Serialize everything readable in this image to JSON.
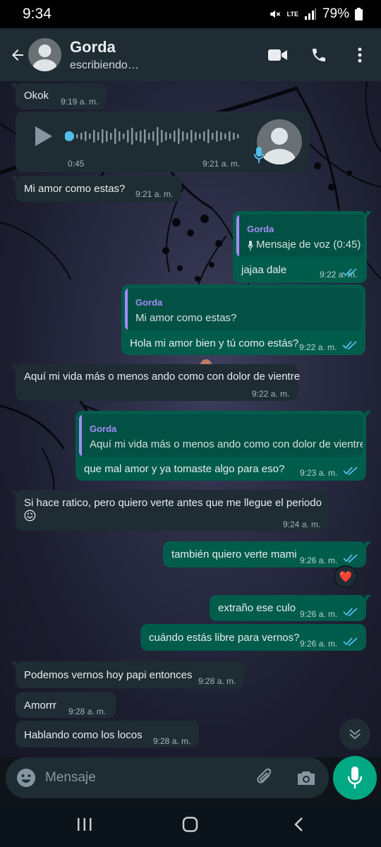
{
  "status_bar": {
    "time": "9:34",
    "network": "LTE",
    "battery": "79%"
  },
  "header": {
    "contact_name": "Gorda",
    "contact_status": "escribiendo…",
    "icons": [
      "back-arrow-icon",
      "avatar-icon",
      "video-call-icon",
      "phone-icon",
      "more-options-icon"
    ]
  },
  "messages": [
    {
      "type": "in",
      "text": "Okok",
      "time": "9:19 a. m."
    },
    {
      "type": "in-voice",
      "duration": "0:45",
      "time": "9:21 a. m."
    },
    {
      "type": "in",
      "text": "Mi amor como estas?",
      "time": "9:21 a. m."
    },
    {
      "type": "out-reply",
      "quote_author": "Gorda",
      "quote_text": "Mensaje de voz (0:45)",
      "text": "jajaa dale",
      "time": "9:22 a. m.",
      "status": "read"
    },
    {
      "type": "out-reply",
      "quote_author": "Gorda",
      "quote_text": "Mi amor como estas?",
      "text": "Hola mi amor bien y tú como estás?",
      "time": "9:22 a. m.",
      "status": "read"
    },
    {
      "type": "in",
      "text": "Aquí mi vida más o menos ando como con dolor de vientre",
      "time": "9:22 a. m."
    },
    {
      "type": "out-reply",
      "quote_author": "Gorda",
      "quote_text": "Aquí mi vida más o menos ando como con dolor de vientre",
      "text": "que mal amor y ya tomaste algo para eso?",
      "time": "9:23 a. m.",
      "status": "read"
    },
    {
      "type": "in",
      "text": "Si hace ratico, pero quiero verte antes que me llegue el periodo",
      "emoji": "😖",
      "time": "9:24 a. m."
    },
    {
      "type": "out",
      "text": "también quiero verte mami",
      "time": "9:26 a. m.",
      "status": "read",
      "reaction": "❤️"
    },
    {
      "type": "out",
      "text": "extraño ese culo",
      "time": "9:26 a. m.",
      "status": "read"
    },
    {
      "type": "out",
      "text": "cuándo estás libre para vernos?",
      "time": "9:26 a. m.",
      "status": "read"
    },
    {
      "type": "in",
      "text": "Podemos vernos hoy papi entonces",
      "time": "9:28 a. m."
    },
    {
      "type": "in",
      "text": "Amorrr",
      "time": "9:28 a. m."
    },
    {
      "type": "in",
      "text": "Hablando como los locos",
      "time": "9:28 a. m."
    }
  ],
  "input": {
    "placeholder": "Mensaje"
  },
  "colors": {
    "incoming": "#1f2c33",
    "outgoing": "#005c4b",
    "accent": "#00a884",
    "read_ticks": "#53bdeb"
  }
}
